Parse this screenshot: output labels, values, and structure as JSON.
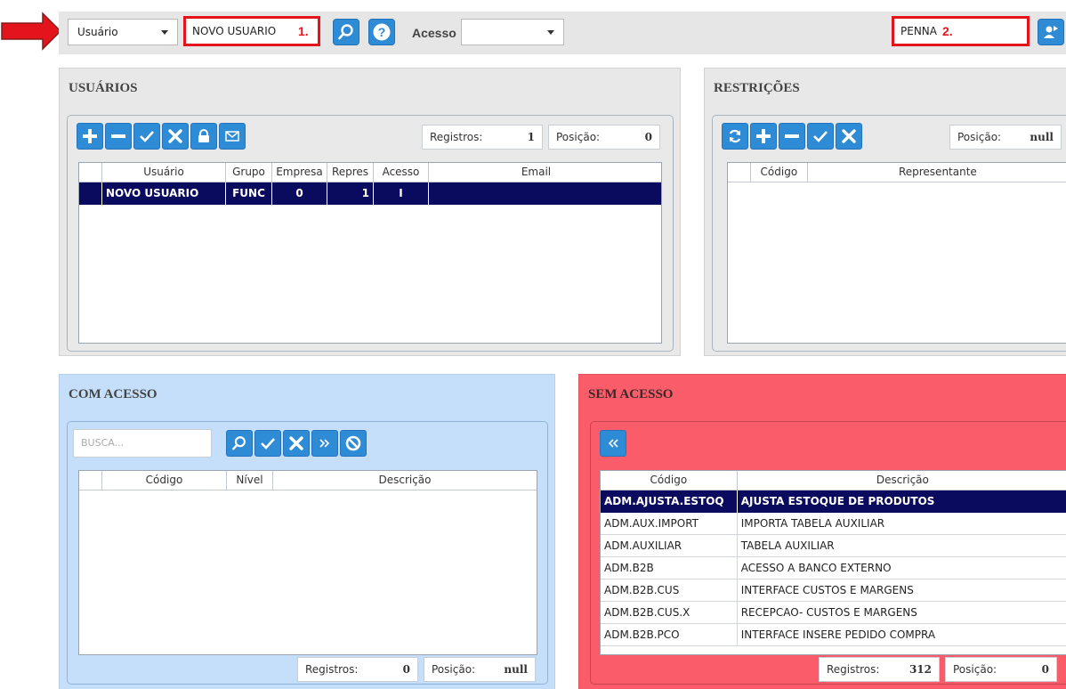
{
  "toolbar": {
    "type_select_value": "Usuário",
    "user_field_value": "NOVO USUARIO",
    "marker_1": "1.",
    "access_label": "Acesso",
    "access_select_value": "",
    "rep_field_value": "PENNA",
    "marker_2": "2."
  },
  "usuarios": {
    "title": "USUÁRIOS",
    "registros_label": "Registros:",
    "registros_value": "1",
    "posicao_label": "Posição:",
    "posicao_value": "0",
    "columns": [
      "Usuário",
      "Grupo",
      "Empresa",
      "Repres",
      "Acesso",
      "Email"
    ],
    "rows": [
      {
        "usuario": "NOVO USUARIO",
        "grupo": "FUNC",
        "empresa": "0",
        "repres": "1",
        "acesso": "I",
        "email": ""
      }
    ]
  },
  "restricoes": {
    "title": "RESTRIÇÕES",
    "posicao_label": "Posição:",
    "posicao_value": "null",
    "columns": [
      "Código",
      "Representante"
    ]
  },
  "com_acesso": {
    "title": "COM ACESSO",
    "search_placeholder": "BUSCA...",
    "columns": [
      "Código",
      "Nível",
      "Descrição"
    ],
    "registros_label": "Registros:",
    "registros_value": "0",
    "posicao_label": "Posição:",
    "posicao_value": "null"
  },
  "sem_acesso": {
    "title": "SEM ACESSO",
    "columns": [
      "Código",
      "Descrição"
    ],
    "rows": [
      {
        "codigo": "ADM.AJUSTA.ESTOQ",
        "descricao": "AJUSTA ESTOQUE DE PRODUTOS"
      },
      {
        "codigo": "ADM.AUX.IMPORT",
        "descricao": "IMPORTA TABELA AUXILIAR"
      },
      {
        "codigo": "ADM.AUXILIAR",
        "descricao": "TABELA AUXILIAR"
      },
      {
        "codigo": "ADM.B2B",
        "descricao": "ACESSO A BANCO EXTERNO"
      },
      {
        "codigo": "ADM.B2B.CUS",
        "descricao": "INTERFACE CUSTOS E MARGENS"
      },
      {
        "codigo": "ADM.B2B.CUS.X",
        "descricao": "RECEPCAO- CUSTOS E MARGENS"
      },
      {
        "codigo": "ADM.B2B.PCO",
        "descricao": "INTERFACE INSERE PEDIDO COMPRA"
      }
    ],
    "registros_label": "Registros:",
    "registros_value": "312",
    "posicao_label": "Posição:",
    "posicao_value": "0"
  },
  "colors": {
    "accent": "#2e8bd6",
    "selected_row": "#0a0a5e",
    "highlight_red": "#e3141b",
    "com_acesso_bg": "#c5dffa",
    "sem_acesso_bg": "#fa5c6a"
  }
}
